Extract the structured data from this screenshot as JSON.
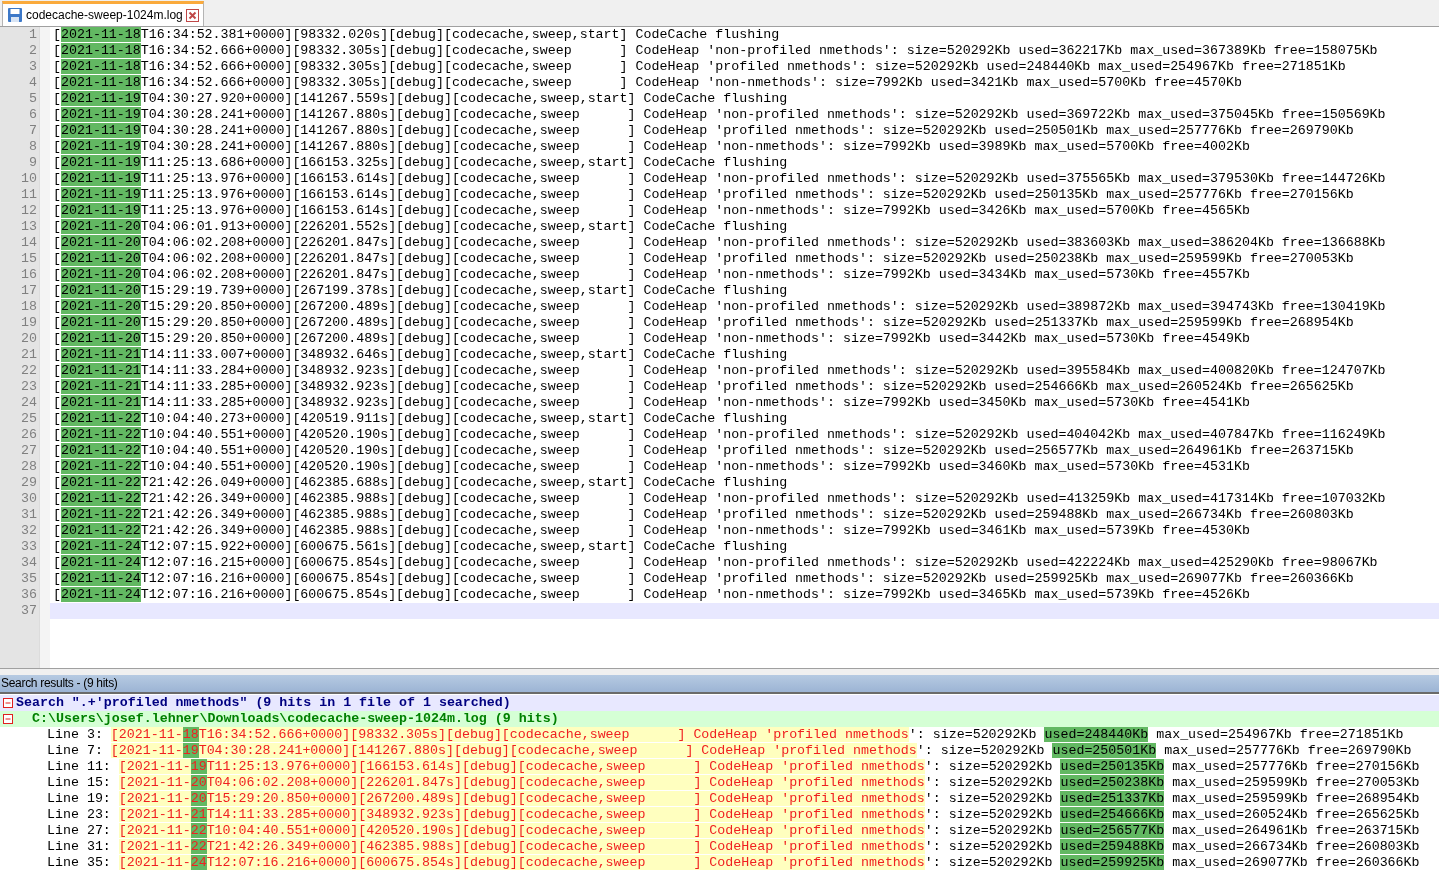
{
  "tab": {
    "title": "codecache-sweep-1024m.log",
    "selected": true
  },
  "editor": {
    "lines": [
      {
        "number": "1",
        "pre": "[",
        "mark": "2021-11-18",
        "post": "T16:34:52.381+0000][98332.020s][debug][codecache,sweep,start] CodeCache flushing",
        "current": false
      },
      {
        "number": "2",
        "pre": "[",
        "mark": "2021-11-18",
        "post": "T16:34:52.666+0000][98332.305s][debug][codecache,sweep      ] CodeHeap 'non-profiled nmethods': size=520292Kb used=362217Kb max_used=367389Kb free=158075Kb",
        "current": false
      },
      {
        "number": "3",
        "pre": "[",
        "mark": "2021-11-18",
        "post": "T16:34:52.666+0000][98332.305s][debug][codecache,sweep      ] CodeHeap 'profiled nmethods': size=520292Kb used=248440Kb max_used=254967Kb free=271851Kb",
        "current": false
      },
      {
        "number": "4",
        "pre": "[",
        "mark": "2021-11-18",
        "post": "T16:34:52.666+0000][98332.305s][debug][codecache,sweep      ] CodeHeap 'non-nmethods': size=7992Kb used=3421Kb max_used=5700Kb free=4570Kb",
        "current": false
      },
      {
        "number": "5",
        "pre": "[",
        "mark": "2021-11-19",
        "post": "T04:30:27.920+0000][141267.559s][debug][codecache,sweep,start] CodeCache flushing",
        "current": false
      },
      {
        "number": "6",
        "pre": "[",
        "mark": "2021-11-19",
        "post": "T04:30:28.241+0000][141267.880s][debug][codecache,sweep      ] CodeHeap 'non-profiled nmethods': size=520292Kb used=369722Kb max_used=375045Kb free=150569Kb",
        "current": false
      },
      {
        "number": "7",
        "pre": "[",
        "mark": "2021-11-19",
        "post": "T04:30:28.241+0000][141267.880s][debug][codecache,sweep      ] CodeHeap 'profiled nmethods': size=520292Kb used=250501Kb max_used=257776Kb free=269790Kb",
        "current": false
      },
      {
        "number": "8",
        "pre": "[",
        "mark": "2021-11-19",
        "post": "T04:30:28.241+0000][141267.880s][debug][codecache,sweep      ] CodeHeap 'non-nmethods': size=7992Kb used=3989Kb max_used=5700Kb free=4002Kb",
        "current": false
      },
      {
        "number": "9",
        "pre": "[",
        "mark": "2021-11-19",
        "post": "T11:25:13.686+0000][166153.325s][debug][codecache,sweep,start] CodeCache flushing",
        "current": false
      },
      {
        "number": "10",
        "pre": "[",
        "mark": "2021-11-19",
        "post": "T11:25:13.976+0000][166153.614s][debug][codecache,sweep      ] CodeHeap 'non-profiled nmethods': size=520292Kb used=375565Kb max_used=379530Kb free=144726Kb",
        "current": false
      },
      {
        "number": "11",
        "pre": "[",
        "mark": "2021-11-19",
        "post": "T11:25:13.976+0000][166153.614s][debug][codecache,sweep      ] CodeHeap 'profiled nmethods': size=520292Kb used=250135Kb max_used=257776Kb free=270156Kb",
        "current": false
      },
      {
        "number": "12",
        "pre": "[",
        "mark": "2021-11-19",
        "post": "T11:25:13.976+0000][166153.614s][debug][codecache,sweep      ] CodeHeap 'non-nmethods': size=7992Kb used=3426Kb max_used=5700Kb free=4565Kb",
        "current": false
      },
      {
        "number": "13",
        "pre": "[",
        "mark": "2021-11-20",
        "post": "T04:06:01.913+0000][226201.552s][debug][codecache,sweep,start] CodeCache flushing",
        "current": false
      },
      {
        "number": "14",
        "pre": "[",
        "mark": "2021-11-20",
        "post": "T04:06:02.208+0000][226201.847s][debug][codecache,sweep      ] CodeHeap 'non-profiled nmethods': size=520292Kb used=383603Kb max_used=386204Kb free=136688Kb",
        "current": false
      },
      {
        "number": "15",
        "pre": "[",
        "mark": "2021-11-20",
        "post": "T04:06:02.208+0000][226201.847s][debug][codecache,sweep      ] CodeHeap 'profiled nmethods': size=520292Kb used=250238Kb max_used=259599Kb free=270053Kb",
        "current": false
      },
      {
        "number": "16",
        "pre": "[",
        "mark": "2021-11-20",
        "post": "T04:06:02.208+0000][226201.847s][debug][codecache,sweep      ] CodeHeap 'non-nmethods': size=7992Kb used=3434Kb max_used=5730Kb free=4557Kb",
        "current": false
      },
      {
        "number": "17",
        "pre": "[",
        "mark": "2021-11-20",
        "post": "T15:29:19.739+0000][267199.378s][debug][codecache,sweep,start] CodeCache flushing",
        "current": false
      },
      {
        "number": "18",
        "pre": "[",
        "mark": "2021-11-20",
        "post": "T15:29:20.850+0000][267200.489s][debug][codecache,sweep      ] CodeHeap 'non-profiled nmethods': size=520292Kb used=389872Kb max_used=394743Kb free=130419Kb",
        "current": false
      },
      {
        "number": "19",
        "pre": "[",
        "mark": "2021-11-20",
        "post": "T15:29:20.850+0000][267200.489s][debug][codecache,sweep      ] CodeHeap 'profiled nmethods': size=520292Kb used=251337Kb max_used=259599Kb free=268954Kb",
        "current": false
      },
      {
        "number": "20",
        "pre": "[",
        "mark": "2021-11-20",
        "post": "T15:29:20.850+0000][267200.489s][debug][codecache,sweep      ] CodeHeap 'non-nmethods': size=7992Kb used=3442Kb max_used=5730Kb free=4549Kb",
        "current": false
      },
      {
        "number": "21",
        "pre": "[",
        "mark": "2021-11-21",
        "post": "T14:11:33.007+0000][348932.646s][debug][codecache,sweep,start] CodeCache flushing",
        "current": false
      },
      {
        "number": "22",
        "pre": "[",
        "mark": "2021-11-21",
        "post": "T14:11:33.284+0000][348932.923s][debug][codecache,sweep      ] CodeHeap 'non-profiled nmethods': size=520292Kb used=395584Kb max_used=400820Kb free=124707Kb",
        "current": false
      },
      {
        "number": "23",
        "pre": "[",
        "mark": "2021-11-21",
        "post": "T14:11:33.285+0000][348932.923s][debug][codecache,sweep      ] CodeHeap 'profiled nmethods': size=520292Kb used=254666Kb max_used=260524Kb free=265625Kb",
        "current": false
      },
      {
        "number": "24",
        "pre": "[",
        "mark": "2021-11-21",
        "post": "T14:11:33.285+0000][348932.923s][debug][codecache,sweep      ] CodeHeap 'non-nmethods': size=7992Kb used=3450Kb max_used=5730Kb free=4541Kb",
        "current": false
      },
      {
        "number": "25",
        "pre": "[",
        "mark": "2021-11-22",
        "post": "T10:04:40.273+0000][420519.911s][debug][codecache,sweep,start] CodeCache flushing",
        "current": false
      },
      {
        "number": "26",
        "pre": "[",
        "mark": "2021-11-22",
        "post": "T10:04:40.551+0000][420520.190s][debug][codecache,sweep      ] CodeHeap 'non-profiled nmethods': size=520292Kb used=404042Kb max_used=407847Kb free=116249Kb",
        "current": false
      },
      {
        "number": "27",
        "pre": "[",
        "mark": "2021-11-22",
        "post": "T10:04:40.551+0000][420520.190s][debug][codecache,sweep      ] CodeHeap 'profiled nmethods': size=520292Kb used=256577Kb max_used=264961Kb free=263715Kb",
        "current": false
      },
      {
        "number": "28",
        "pre": "[",
        "mark": "2021-11-22",
        "post": "T10:04:40.551+0000][420520.190s][debug][codecache,sweep      ] CodeHeap 'non-nmethods': size=7992Kb used=3460Kb max_used=5730Kb free=4531Kb",
        "current": false
      },
      {
        "number": "29",
        "pre": "[",
        "mark": "2021-11-22",
        "post": "T21:42:26.049+0000][462385.688s][debug][codecache,sweep,start] CodeCache flushing",
        "current": false
      },
      {
        "number": "30",
        "pre": "[",
        "mark": "2021-11-22",
        "post": "T21:42:26.349+0000][462385.988s][debug][codecache,sweep      ] CodeHeap 'non-profiled nmethods': size=520292Kb used=413259Kb max_used=417314Kb free=107032Kb",
        "current": false
      },
      {
        "number": "31",
        "pre": "[",
        "mark": "2021-11-22",
        "post": "T21:42:26.349+0000][462385.988s][debug][codecache,sweep      ] CodeHeap 'profiled nmethods': size=520292Kb used=259488Kb max_used=266734Kb free=260803Kb",
        "current": false
      },
      {
        "number": "32",
        "pre": "[",
        "mark": "2021-11-22",
        "post": "T21:42:26.349+0000][462385.988s][debug][codecache,sweep      ] CodeHeap 'non-nmethods': size=7992Kb used=3461Kb max_used=5739Kb free=4530Kb",
        "current": false
      },
      {
        "number": "33",
        "pre": "[",
        "mark": "2021-11-24",
        "post": "T12:07:15.922+0000][600675.561s][debug][codecache,sweep,start] CodeCache flushing",
        "current": false
      },
      {
        "number": "34",
        "pre": "[",
        "mark": "2021-11-24",
        "post": "T12:07:16.215+0000][600675.854s][debug][codecache,sweep      ] CodeHeap 'non-profiled nmethods': size=520292Kb used=422224Kb max_used=425290Kb free=98067Kb",
        "current": false
      },
      {
        "number": "35",
        "pre": "[",
        "mark": "2021-11-24",
        "post": "T12:07:16.216+0000][600675.854s][debug][codecache,sweep      ] CodeHeap 'profiled nmethods': size=520292Kb used=259925Kb max_used=269077Kb free=260366Kb",
        "current": false
      },
      {
        "number": "36",
        "pre": "[",
        "mark": "2021-11-24",
        "post": "T12:07:16.216+0000][600675.854s][debug][codecache,sweep      ] CodeHeap 'non-nmethods': size=7992Kb used=3465Kb max_used=5739Kb free=4526Kb",
        "current": false
      },
      {
        "number": "37",
        "current": true
      }
    ]
  },
  "search_panel": {
    "title": "Search results - (9 hits)",
    "search": {
      "text": "Search \".+'profiled nmethods\" (9 hits in 1 file of 1 searched)",
      "expanded": true
    },
    "file": {
      "text": "C:\\Users\\josef.lehner\\Downloads\\codecache-sweep-1024m.log (9 hits)",
      "expanded": true
    },
    "hits": [
      {
        "label": "Line 3:",
        "parts": [
          {
            "text": "[2021-11-",
            "kind": "match",
            "marked": false
          },
          {
            "text": "18",
            "kind": "match",
            "marked": true
          },
          {
            "text": "T16:34:52.666+0000][98332.305s][debug][codecache,sweep      ] CodeHeap 'profiled nmethods",
            "kind": "match",
            "marked": false
          },
          {
            "text": "': size=520292Kb ",
            "kind": "context",
            "marked": false
          },
          {
            "text": "used=248440Kb",
            "kind": "context",
            "marked": true
          },
          {
            "text": " max_used=254967Kb free=271851Kb",
            "kind": "context",
            "marked": false
          }
        ]
      },
      {
        "label": "Line 7:",
        "parts": [
          {
            "text": "[2021-11-",
            "kind": "match",
            "marked": false
          },
          {
            "text": "19",
            "kind": "match",
            "marked": true
          },
          {
            "text": "T04:30:28.241+0000][141267.880s][debug][codecache,sweep      ] CodeHeap 'profiled nmethods",
            "kind": "match",
            "marked": false
          },
          {
            "text": "': size=520292Kb ",
            "kind": "context",
            "marked": false
          },
          {
            "text": "used=250501Kb",
            "kind": "context",
            "marked": true
          },
          {
            "text": " max_used=257776Kb free=269790Kb",
            "kind": "context",
            "marked": false
          }
        ]
      },
      {
        "label": "Line 11:",
        "parts": [
          {
            "text": "[2021-11-",
            "kind": "match",
            "marked": false
          },
          {
            "text": "19",
            "kind": "match",
            "marked": true
          },
          {
            "text": "T11:25:13.976+0000][166153.614s][debug][codecache,sweep      ] CodeHeap 'profiled nmethods",
            "kind": "match",
            "marked": false
          },
          {
            "text": "': size=520292Kb ",
            "kind": "context",
            "marked": false
          },
          {
            "text": "used=250135Kb",
            "kind": "context",
            "marked": true
          },
          {
            "text": " max_used=257776Kb free=270156Kb",
            "kind": "context",
            "marked": false
          }
        ]
      },
      {
        "label": "Line 15:",
        "parts": [
          {
            "text": "[2021-11-",
            "kind": "match",
            "marked": false
          },
          {
            "text": "20",
            "kind": "match",
            "marked": true
          },
          {
            "text": "T04:06:02.208+0000][226201.847s][debug][codecache,sweep      ] CodeHeap 'profiled nmethods",
            "kind": "match",
            "marked": false
          },
          {
            "text": "': size=520292Kb ",
            "kind": "context",
            "marked": false
          },
          {
            "text": "used=250238Kb",
            "kind": "context",
            "marked": true
          },
          {
            "text": " max_used=259599Kb free=270053Kb",
            "kind": "context",
            "marked": false
          }
        ]
      },
      {
        "label": "Line 19:",
        "parts": [
          {
            "text": "[2021-11-",
            "kind": "match",
            "marked": false
          },
          {
            "text": "20",
            "kind": "match",
            "marked": true
          },
          {
            "text": "T15:29:20.850+0000][267200.489s][debug][codecache,sweep      ] CodeHeap 'profiled nmethods",
            "kind": "match",
            "marked": false
          },
          {
            "text": "': size=520292Kb ",
            "kind": "context",
            "marked": false
          },
          {
            "text": "used=251337Kb",
            "kind": "context",
            "marked": true
          },
          {
            "text": " max_used=259599Kb free=268954Kb",
            "kind": "context",
            "marked": false
          }
        ]
      },
      {
        "label": "Line 23:",
        "parts": [
          {
            "text": "[2021-11-",
            "kind": "match",
            "marked": false
          },
          {
            "text": "21",
            "kind": "match",
            "marked": true
          },
          {
            "text": "T14:11:33.285+0000][348932.923s][debug][codecache,sweep      ] CodeHeap 'profiled nmethods",
            "kind": "match",
            "marked": false
          },
          {
            "text": "': size=520292Kb ",
            "kind": "context",
            "marked": false
          },
          {
            "text": "used=254666Kb",
            "kind": "context",
            "marked": true
          },
          {
            "text": " max_used=260524Kb free=265625Kb",
            "kind": "context",
            "marked": false
          }
        ]
      },
      {
        "label": "Line 27:",
        "parts": [
          {
            "text": "[2021-11-",
            "kind": "match",
            "marked": false
          },
          {
            "text": "22",
            "kind": "match",
            "marked": true
          },
          {
            "text": "T10:04:40.551+0000][420520.190s][debug][codecache,sweep      ] CodeHeap 'profiled nmethods",
            "kind": "match",
            "marked": false
          },
          {
            "text": "': size=520292Kb ",
            "kind": "context",
            "marked": false
          },
          {
            "text": "used=256577Kb",
            "kind": "context",
            "marked": true
          },
          {
            "text": " max_used=264961Kb free=263715Kb",
            "kind": "context",
            "marked": false
          }
        ]
      },
      {
        "label": "Line 31:",
        "parts": [
          {
            "text": "[2021-11-",
            "kind": "match",
            "marked": false
          },
          {
            "text": "22",
            "kind": "match",
            "marked": true
          },
          {
            "text": "T21:42:26.349+0000][462385.988s][debug][codecache,sweep      ] CodeHeap 'profiled nmethods",
            "kind": "match",
            "marked": false
          },
          {
            "text": "': size=520292Kb ",
            "kind": "context",
            "marked": false
          },
          {
            "text": "used=259488Kb",
            "kind": "context",
            "marked": true
          },
          {
            "text": " max_used=266734Kb free=260803Kb",
            "kind": "context",
            "marked": false
          }
        ]
      },
      {
        "label": "Line 35:",
        "parts": [
          {
            "text": "[2021-11-",
            "kind": "match",
            "marked": false
          },
          {
            "text": "24",
            "kind": "match",
            "marked": true
          },
          {
            "text": "T12:07:16.216+0000][600675.854s][debug][codecache,sweep      ] CodeHeap 'profiled nmethods",
            "kind": "match",
            "marked": false
          },
          {
            "text": "': size=520292Kb ",
            "kind": "context",
            "marked": false
          },
          {
            "text": "used=259925Kb",
            "kind": "context",
            "marked": true
          },
          {
            "text": " max_used=269077Kb free=260366Kb",
            "kind": "context",
            "marked": false
          }
        ]
      }
    ]
  }
}
